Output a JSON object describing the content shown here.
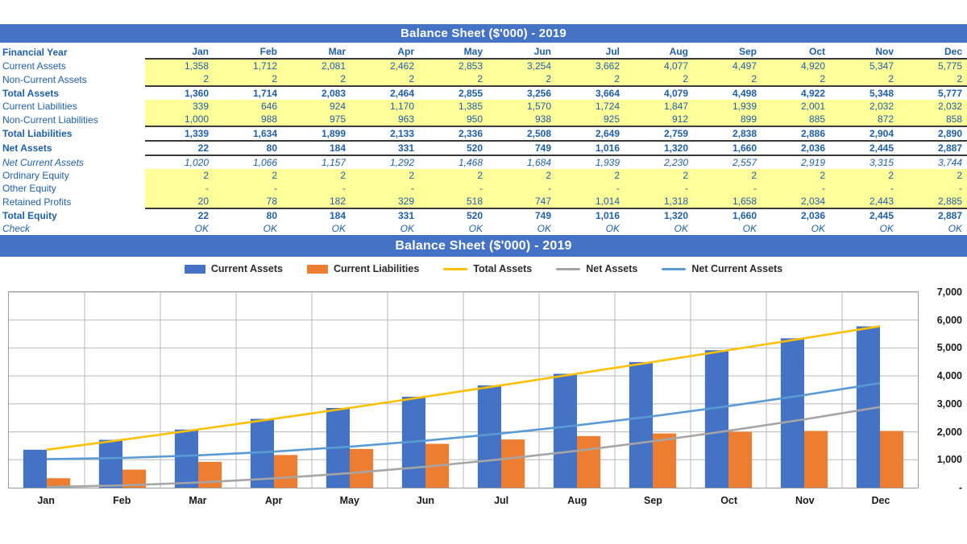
{
  "table": {
    "title": "Balance Sheet ($'000) - 2019",
    "row_header_label": "Financial Year",
    "months": [
      "Jan",
      "Feb",
      "Mar",
      "Apr",
      "May",
      "Jun",
      "Jul",
      "Aug",
      "Sep",
      "Oct",
      "Nov",
      "Dec"
    ],
    "rows": [
      {
        "label": "Current Assets",
        "style": "highlight",
        "values": [
          "1,358",
          "1,712",
          "2,081",
          "2,462",
          "2,853",
          "3,254",
          "3,662",
          "4,077",
          "4,497",
          "4,920",
          "5,347",
          "5,775"
        ]
      },
      {
        "label": "Non-Current Assets",
        "style": "highlight-bottom",
        "values": [
          "2",
          "2",
          "2",
          "2",
          "2",
          "2",
          "2",
          "2",
          "2",
          "2",
          "2",
          "2"
        ]
      },
      {
        "label": "Total Assets",
        "style": "total",
        "values": [
          "1,360",
          "1,714",
          "2,083",
          "2,464",
          "2,855",
          "3,256",
          "3,664",
          "4,079",
          "4,498",
          "4,922",
          "5,348",
          "5,777"
        ]
      },
      {
        "label": "Current Liabilities",
        "style": "highlight",
        "values": [
          "339",
          "646",
          "924",
          "1,170",
          "1,385",
          "1,570",
          "1,724",
          "1,847",
          "1,939",
          "2,001",
          "2,032",
          "2,032"
        ]
      },
      {
        "label": "Non-Current Liabilities",
        "style": "highlight-bottom",
        "values": [
          "1,000",
          "988",
          "975",
          "963",
          "950",
          "938",
          "925",
          "912",
          "899",
          "885",
          "872",
          "858"
        ]
      },
      {
        "label": "Total Liabilities",
        "style": "total",
        "values": [
          "1,339",
          "1,634",
          "1,899",
          "2,133",
          "2,336",
          "2,508",
          "2,649",
          "2,759",
          "2,838",
          "2,886",
          "2,904",
          "2,890"
        ]
      },
      {
        "label": "Net Assets",
        "style": "total-boxed",
        "values": [
          "22",
          "80",
          "184",
          "331",
          "520",
          "749",
          "1,016",
          "1,320",
          "1,660",
          "2,036",
          "2,445",
          "2,887"
        ]
      },
      {
        "label": "Net Current Assets",
        "style": "italic",
        "values": [
          "1,020",
          "1,066",
          "1,157",
          "1,292",
          "1,468",
          "1,684",
          "1,939",
          "2,230",
          "2,557",
          "2,919",
          "3,315",
          "3,744"
        ]
      },
      {
        "label": "Ordinary Equity",
        "style": "highlight",
        "values": [
          "2",
          "2",
          "2",
          "2",
          "2",
          "2",
          "2",
          "2",
          "2",
          "2",
          "2",
          "2"
        ]
      },
      {
        "label": "Other Equity",
        "style": "highlight",
        "values": [
          "-",
          "-",
          "-",
          "-",
          "-",
          "-",
          "-",
          "-",
          "-",
          "-",
          "-",
          "-"
        ]
      },
      {
        "label": "Retained Profits",
        "style": "highlight-bottom",
        "values": [
          "20",
          "78",
          "182",
          "329",
          "518",
          "747",
          "1,014",
          "1,318",
          "1,658",
          "2,034",
          "2,443",
          "2,885"
        ]
      },
      {
        "label": "Total Equity",
        "style": "total",
        "values": [
          "22",
          "80",
          "184",
          "331",
          "520",
          "749",
          "1,016",
          "1,320",
          "1,660",
          "2,036",
          "2,445",
          "2,887"
        ]
      },
      {
        "label": "Check",
        "style": "italic-check",
        "values": [
          "OK",
          "OK",
          "OK",
          "OK",
          "OK",
          "OK",
          "OK",
          "OK",
          "OK",
          "OK",
          "OK",
          "OK"
        ]
      }
    ]
  },
  "chart_data": {
    "type": "bar",
    "title": "Balance Sheet ($'000) - 2019",
    "xlabel": "",
    "ylabel": "",
    "ylim": [
      0,
      7000
    ],
    "yticks": [
      0,
      1000,
      2000,
      3000,
      4000,
      5000,
      6000,
      7000
    ],
    "ytick_labels": [
      "-",
      "1,000",
      "2,000",
      "3,000",
      "4,000",
      "5,000",
      "6,000",
      "7,000"
    ],
    "grid": true,
    "legend_position": "top",
    "categories": [
      "Jan",
      "Feb",
      "Mar",
      "Apr",
      "May",
      "Jun",
      "Jul",
      "Aug",
      "Sep",
      "Oct",
      "Nov",
      "Dec"
    ],
    "series": [
      {
        "name": "Current Assets",
        "chart_type": "bar",
        "color": "#4472C4",
        "values": [
          1358,
          1712,
          2081,
          2462,
          2853,
          3254,
          3662,
          4077,
          4497,
          4920,
          5347,
          5775
        ]
      },
      {
        "name": "Current Liabilities",
        "chart_type": "bar",
        "color": "#ED7D31",
        "values": [
          339,
          646,
          924,
          1170,
          1385,
          1570,
          1724,
          1847,
          1939,
          2001,
          2032,
          2032
        ]
      },
      {
        "name": "Total Assets",
        "chart_type": "line",
        "color": "#FFC000",
        "values": [
          1360,
          1714,
          2083,
          2464,
          2855,
          3256,
          3664,
          4079,
          4498,
          4922,
          5348,
          5777
        ]
      },
      {
        "name": "Net Assets",
        "chart_type": "line",
        "color": "#A5A5A5",
        "values": [
          22,
          80,
          184,
          331,
          520,
          749,
          1016,
          1320,
          1660,
          2036,
          2445,
          2887
        ]
      },
      {
        "name": "Net Current Assets",
        "chart_type": "line",
        "color": "#5B9BD5",
        "values": [
          1020,
          1066,
          1157,
          1292,
          1468,
          1684,
          1939,
          2230,
          2557,
          2919,
          3315,
          3744
        ]
      }
    ]
  },
  "colors": {
    "header_blue": "#4472C4",
    "text_blue": "#1F5FA9",
    "highlight_yellow": "#FFFF99",
    "series_blue": "#4472C4",
    "series_orange": "#ED7D31",
    "series_yellow": "#FFC000",
    "series_grey": "#A5A5A5",
    "series_lightblue": "#5B9BD5"
  }
}
